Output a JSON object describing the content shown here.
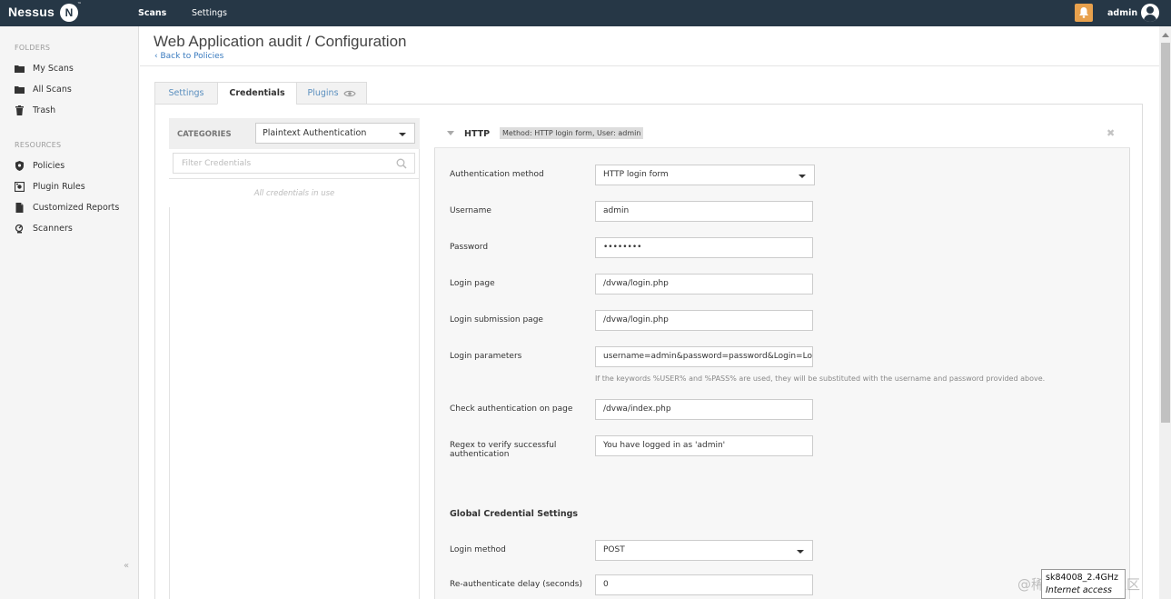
{
  "topbar": {
    "brand": "Nessus",
    "brand_badge": "N",
    "brand_tm": "™",
    "nav": [
      {
        "label": "Scans"
      },
      {
        "label": "Settings"
      }
    ],
    "user": "admin",
    "accent_color": "#263746",
    "bell_color": "#e8a14d"
  },
  "sidebar": {
    "folders_heading": "FOLDERS",
    "folders": [
      {
        "label": "My Scans",
        "icon": "folder-icon"
      },
      {
        "label": "All Scans",
        "icon": "folder-icon"
      },
      {
        "label": "Trash",
        "icon": "trash-icon"
      }
    ],
    "resources_heading": "RESOURCES",
    "resources": [
      {
        "label": "Policies",
        "icon": "shield-icon"
      },
      {
        "label": "Plugin Rules",
        "icon": "plugin-rules-icon"
      },
      {
        "label": "Customized Reports",
        "icon": "report-icon"
      },
      {
        "label": "Scanners",
        "icon": "scanner-icon"
      }
    ],
    "collapse_label": "«"
  },
  "page": {
    "title": "Web Application audit / Configuration",
    "back_link": "‹ Back to Policies"
  },
  "tabs": [
    {
      "label": "Settings",
      "active": false
    },
    {
      "label": "Credentials",
      "active": true
    },
    {
      "label": "Plugins",
      "active": false,
      "icon": "eye-icon"
    }
  ],
  "categories": {
    "label": "CATEGORIES",
    "selected": "Plaintext Authentication",
    "filter_placeholder": "Filter Credentials",
    "note": "All credentials in use"
  },
  "http": {
    "title": "HTTP",
    "badge": "Method: HTTP login form, User: admin",
    "close": "✖",
    "fields": {
      "auth_method_label": "Authentication method",
      "auth_method_value": "HTTP login form",
      "username_label": "Username",
      "username_value": "admin",
      "password_label": "Password",
      "password_value": "••••••••",
      "login_page_label": "Login page",
      "login_page_value": "/dvwa/login.php",
      "login_submit_label": "Login submission page",
      "login_submit_value": "/dvwa/login.php",
      "login_params_label": "Login parameters",
      "login_params_value": "username=admin&password=password&Login=Login",
      "login_params_hint": "If the keywords %USER% and %PASS% are used, they will be substituted with the username and password provided above.",
      "check_auth_label": "Check authentication on page",
      "check_auth_value": "/dvwa/index.php",
      "regex_label_line1": "Regex to verify successful",
      "regex_label_line2": "authentication",
      "regex_value": "You have logged in as 'admin'"
    },
    "global": {
      "title": "Global Credential Settings",
      "login_method_label": "Login method",
      "login_method_value": "POST",
      "reauth_label": "Re-authenticate delay (seconds)",
      "reauth_value": "0"
    }
  },
  "overlay": {
    "network_name": "sk84008_2.4GHz",
    "network_status": "Internet access",
    "watermark": "@稀土掘金技术社区"
  }
}
